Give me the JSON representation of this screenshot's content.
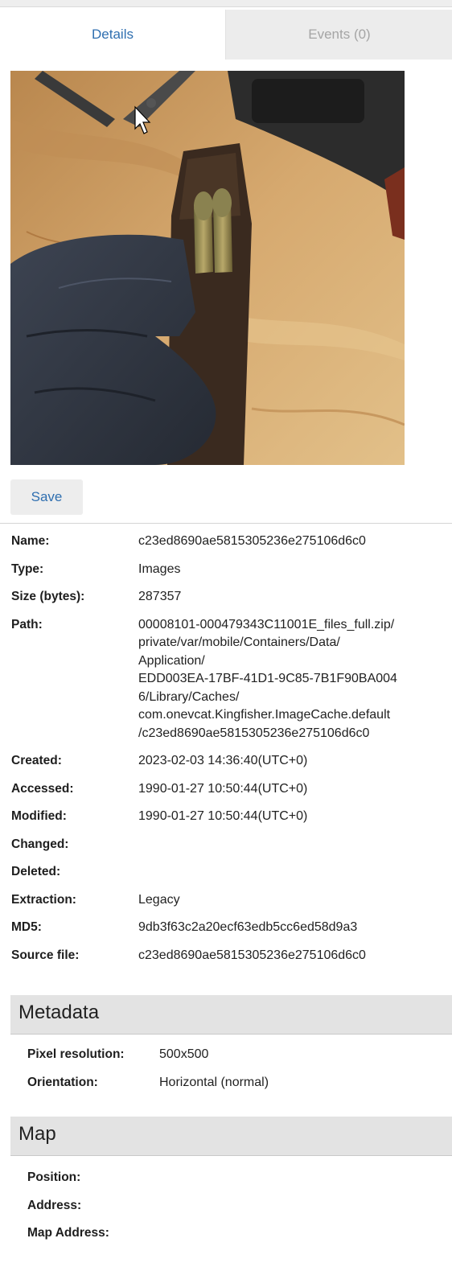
{
  "tabs": [
    {
      "label": "Details"
    },
    {
      "label": "Events (0)"
    }
  ],
  "save_label": "Save",
  "properties": [
    {
      "key": "Name:",
      "value": "c23ed8690ae5815305236e275106d6c0"
    },
    {
      "key": "Type:",
      "value": "Images"
    },
    {
      "key": "Size (bytes):",
      "value": "287357"
    },
    {
      "key": "Path:",
      "value": "00008101-000479343C11001E_files_full.zip/\nprivate/var/mobile/Containers/Data/\nApplication/\nEDD003EA-17BF-41D1-9C85-7B1F90BA004\n6/Library/Caches/\ncom.onevcat.Kingfisher.ImageCache.default\n/c23ed8690ae5815305236e275106d6c0"
    },
    {
      "key": "Created:",
      "value": "2023-02-03 14:36:40(UTC+0)"
    },
    {
      "key": "Accessed:",
      "value": "1990-01-27 10:50:44(UTC+0)"
    },
    {
      "key": "Modified:",
      "value": "1990-01-27 10:50:44(UTC+0)"
    },
    {
      "key": "Changed:",
      "value": ""
    },
    {
      "key": "Deleted:",
      "value": ""
    },
    {
      "key": "Extraction:",
      "value": "Legacy"
    },
    {
      "key": "MD5:",
      "value": "9db3f63c2a20ecf63edb5cc6ed58d9a3"
    },
    {
      "key": "Source file:",
      "value": "c23ed8690ae5815305236e275106d6c0"
    }
  ],
  "metadata": {
    "title": "Metadata",
    "rows": [
      {
        "key": "Pixel resolution:",
        "value": "500x500"
      },
      {
        "key": "Orientation:",
        "value": "Horizontal (normal)"
      }
    ]
  },
  "map": {
    "title": "Map",
    "rows": [
      {
        "key": "Position:",
        "value": ""
      },
      {
        "key": "Address:",
        "value": ""
      },
      {
        "key": "Map Address:",
        "value": ""
      }
    ]
  }
}
